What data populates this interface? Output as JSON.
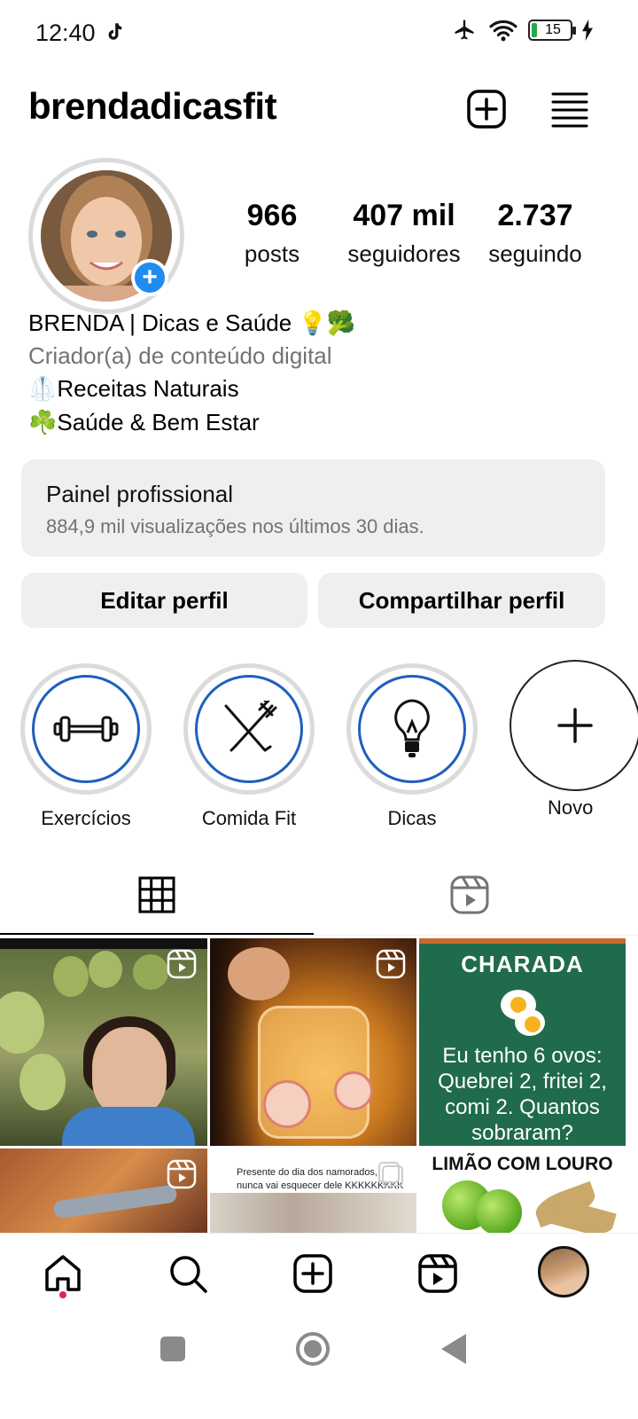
{
  "status_bar": {
    "time": "12:40",
    "battery": "15",
    "icons": [
      "tiktok-icon",
      "airplane-icon",
      "wifi-icon",
      "battery-icon",
      "charging-icon"
    ]
  },
  "header": {
    "username": "brendadicasfit",
    "icons": [
      "new-post-icon",
      "menu-icon"
    ]
  },
  "profile": {
    "stats": [
      {
        "value": "966",
        "label": "posts"
      },
      {
        "value": "407 mil",
        "label": "seguidores"
      },
      {
        "value": "2.737",
        "label": "seguindo"
      }
    ],
    "bio": {
      "name": "BRENDA | Dicas e Saúde 💡🥦",
      "category": "Criador(a) de conteúdo digital",
      "line1": "🥼Receitas Naturais",
      "line2": "☘️Saúde & Bem Estar"
    }
  },
  "dashboard": {
    "title": "Painel profissional",
    "subtitle": "884,9 mil visualizações nos últimos 30 dias."
  },
  "buttons": {
    "edit": "Editar perfil",
    "share": "Compartilhar perfil"
  },
  "highlights": [
    {
      "label": "Exercícios",
      "icon": "dumbbell-icon"
    },
    {
      "label": "Comida Fit",
      "icon": "fork-knife-icon"
    },
    {
      "label": "Dicas",
      "icon": "lightbulb-icon"
    },
    {
      "label": "Novo",
      "icon": "plus-icon"
    }
  ],
  "tabs": [
    "grid-icon",
    "reels-icon"
  ],
  "grid": {
    "post3_title": "CHARADA",
    "post3_text": "Eu tenho 6 ovos: Quebrei 2, fritei 2, comi 2. Quantos sobraram?",
    "post5_text": "Presente do dia dos namorados, ele nunca vai esquecer dele KKKKKKKKK",
    "post6_title": "LIMÃO COM LOURO"
  },
  "bottom_nav": [
    "home-icon",
    "search-icon",
    "create-icon",
    "reels-icon",
    "profile-avatar"
  ],
  "colors": {
    "accent": "#1f8cf0",
    "highlight_ring": "#1f5fbf",
    "button_bg": "#efefef",
    "notification_dot": "#e0245e"
  }
}
